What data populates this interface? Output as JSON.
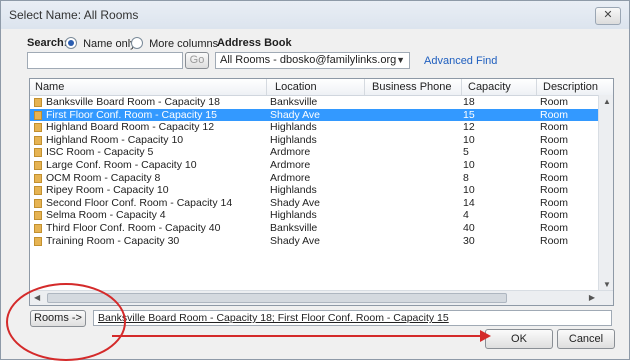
{
  "window": {
    "title": "Select Name: All Rooms",
    "close_label": "✕"
  },
  "search": {
    "label": "Search:",
    "option_name_only": "Name only",
    "option_more_columns": "More columns",
    "query": "",
    "go_label": "Go"
  },
  "address_book": {
    "label": "Address Book",
    "selected": "All Rooms - dbosko@familylinks.org",
    "advanced_find": "Advanced Find"
  },
  "table": {
    "columns": [
      "Name",
      "Location",
      "Business Phone",
      "Capacity",
      "Description"
    ],
    "rows": [
      {
        "name": "Banksville Board Room - Capacity 18",
        "location": "Banksville",
        "phone": "",
        "capacity": "18",
        "description": "Room"
      },
      {
        "name": "First Floor Conf. Room - Capacity 15",
        "location": "Shady Ave",
        "phone": "",
        "capacity": "15",
        "description": "Room"
      },
      {
        "name": "Highland Board Room - Capacity 12",
        "location": "Highlands",
        "phone": "",
        "capacity": "12",
        "description": "Room"
      },
      {
        "name": "Highland Room - Capacity 10",
        "location": "Highlands",
        "phone": "",
        "capacity": "10",
        "description": "Room"
      },
      {
        "name": "ISC Room - Capacity 5",
        "location": "Ardmore",
        "phone": "",
        "capacity": "5",
        "description": "Room"
      },
      {
        "name": "Large Conf. Room - Capacity 10",
        "location": "Ardmore",
        "phone": "",
        "capacity": "10",
        "description": "Room"
      },
      {
        "name": "OCM Room - Capacity 8",
        "location": "Ardmore",
        "phone": "",
        "capacity": "8",
        "description": "Room"
      },
      {
        "name": "Ripey Room - Capacity 10",
        "location": "Highlands",
        "phone": "",
        "capacity": "10",
        "description": "Room"
      },
      {
        "name": "Second Floor Conf. Room - Capacity 14",
        "location": "Shady Ave",
        "phone": "",
        "capacity": "14",
        "description": "Room"
      },
      {
        "name": "Selma Room - Capacity 4",
        "location": "Highlands",
        "phone": "",
        "capacity": "4",
        "description": "Room"
      },
      {
        "name": "Third Floor Conf. Room - Capacity  40",
        "location": "Banksville",
        "phone": "",
        "capacity": "40",
        "description": "Room"
      },
      {
        "name": "Training Room - Capacity 30",
        "location": "Shady Ave",
        "phone": "",
        "capacity": "30",
        "description": "Room"
      }
    ],
    "selected_index": 1
  },
  "rooms": {
    "button_label": "Rooms ->",
    "value": "Banksville Board Room - Capacity 18; First Floor Conf. Room - Capacity 15"
  },
  "footer": {
    "ok_label": "OK",
    "cancel_label": "Cancel"
  },
  "colors": {
    "selection": "#3399ff",
    "annotation": "#d42a2a",
    "link": "#1f5fbf"
  }
}
